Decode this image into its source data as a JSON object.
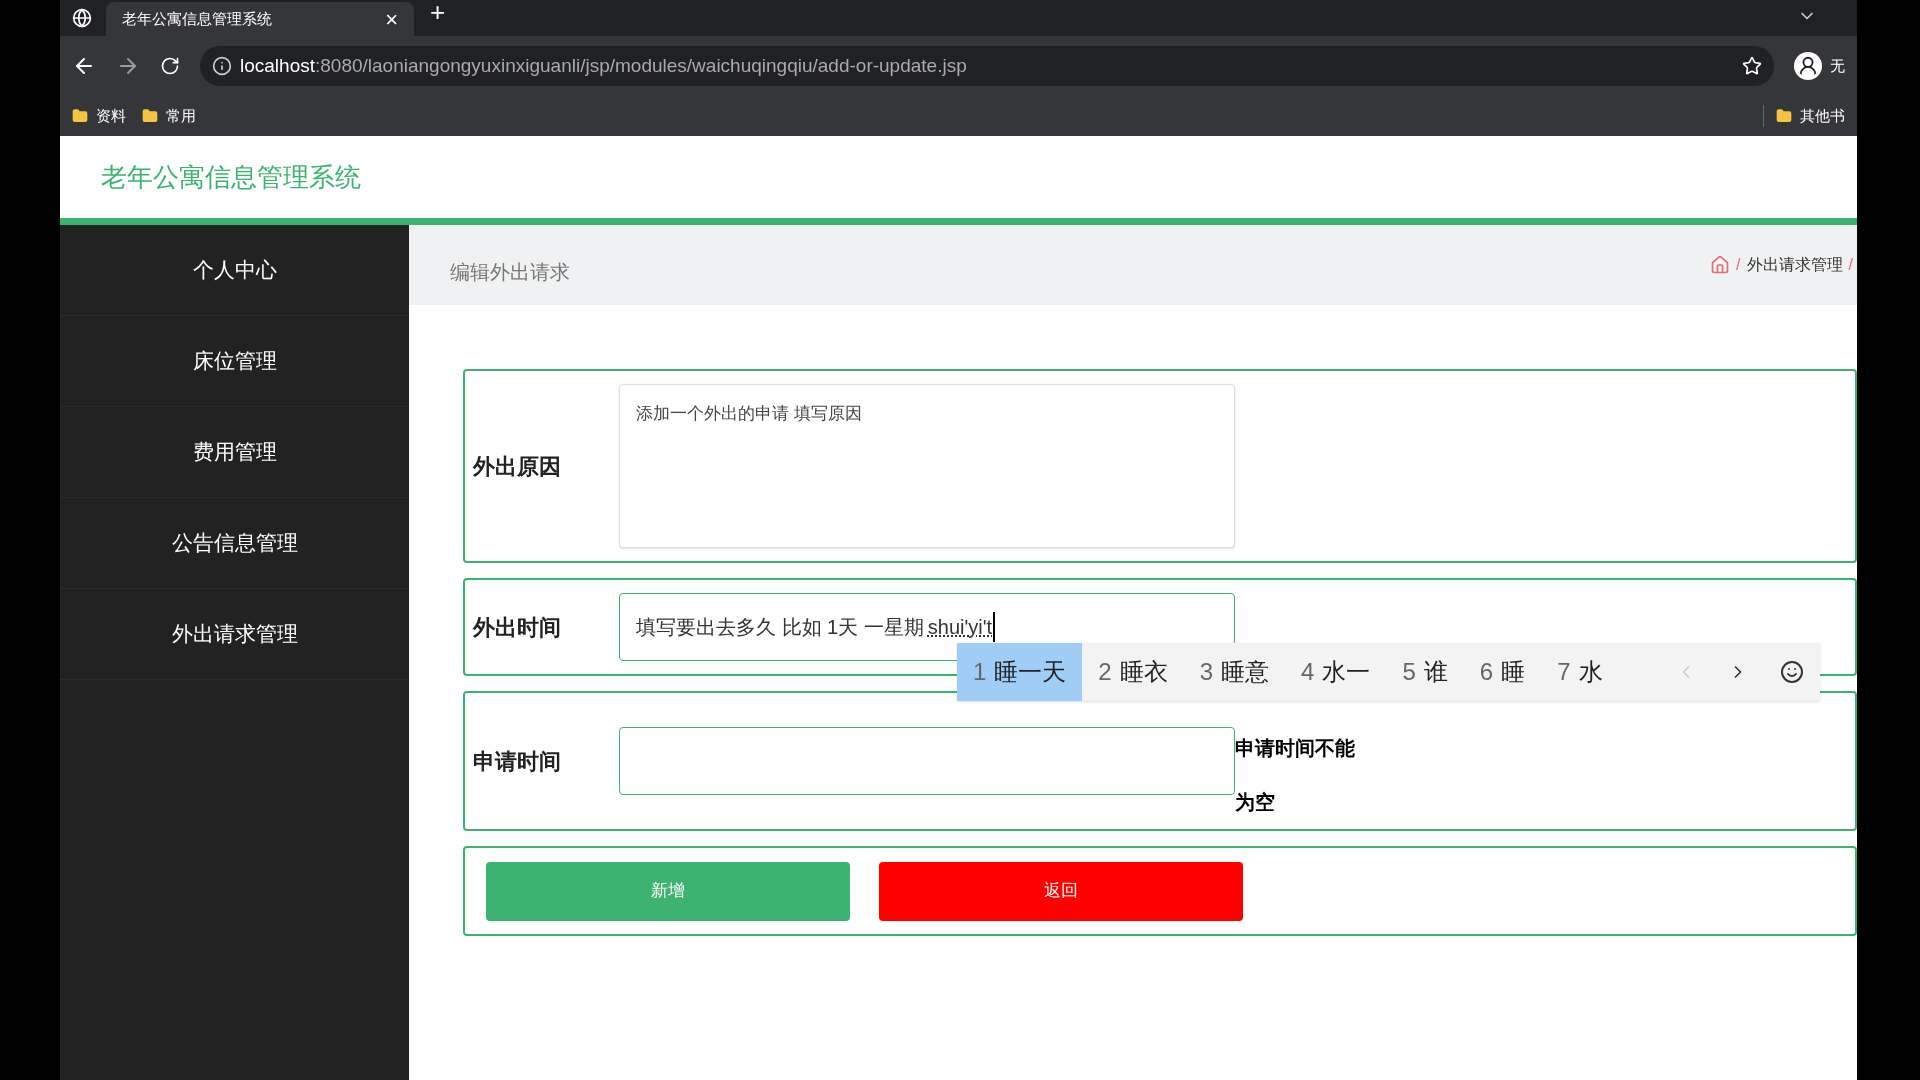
{
  "browser": {
    "tab": {
      "title": "老年公寓信息管理系统",
      "close": "×"
    },
    "new_tab": "+",
    "url": {
      "host": "localhost",
      "rest": ":8080/laoniangongyuxinxiguanli/jsp/modules/waichuqingqiu/add-or-update.jsp"
    },
    "profile": "无",
    "bookmarks": [
      "资料",
      "常用"
    ],
    "other_bookmarks": "其他书"
  },
  "app": {
    "title": "老年公寓信息管理系统"
  },
  "sidebar": {
    "items": [
      {
        "label": "个人中心"
      },
      {
        "label": "床位管理"
      },
      {
        "label": "费用管理"
      },
      {
        "label": "公告信息管理"
      },
      {
        "label": "外出请求管理"
      }
    ]
  },
  "page": {
    "title": "编辑外出请求",
    "breadcrumb": {
      "separator": "/",
      "items": [
        "外出请求管理"
      ]
    }
  },
  "form": {
    "fields": [
      {
        "kind": "textarea",
        "label": "外出原因",
        "value": "添加一个外出的申请 填写原因"
      },
      {
        "kind": "input",
        "label": "外出时间",
        "value": "填写要出去多久 比如 1天 一星期",
        "composing": "shui'yi't"
      },
      {
        "kind": "input",
        "label": "申请时间",
        "error": "申请时间不能为空"
      }
    ],
    "buttons": [
      {
        "kind": "primary",
        "label": "新增"
      },
      {
        "kind": "danger",
        "label": "返回"
      }
    ]
  },
  "ime": {
    "candidates": [
      {
        "index": "1",
        "text": "睡一天",
        "selected": true
      },
      {
        "index": "2",
        "text": "睡衣",
        "selected": false
      },
      {
        "index": "3",
        "text": "睡意",
        "selected": false
      },
      {
        "index": "4",
        "text": "水一",
        "selected": false
      },
      {
        "index": "5",
        "text": "谁",
        "selected": false
      },
      {
        "index": "6",
        "text": "睡",
        "selected": false
      },
      {
        "index": "7",
        "text": "水",
        "selected": false
      }
    ]
  }
}
